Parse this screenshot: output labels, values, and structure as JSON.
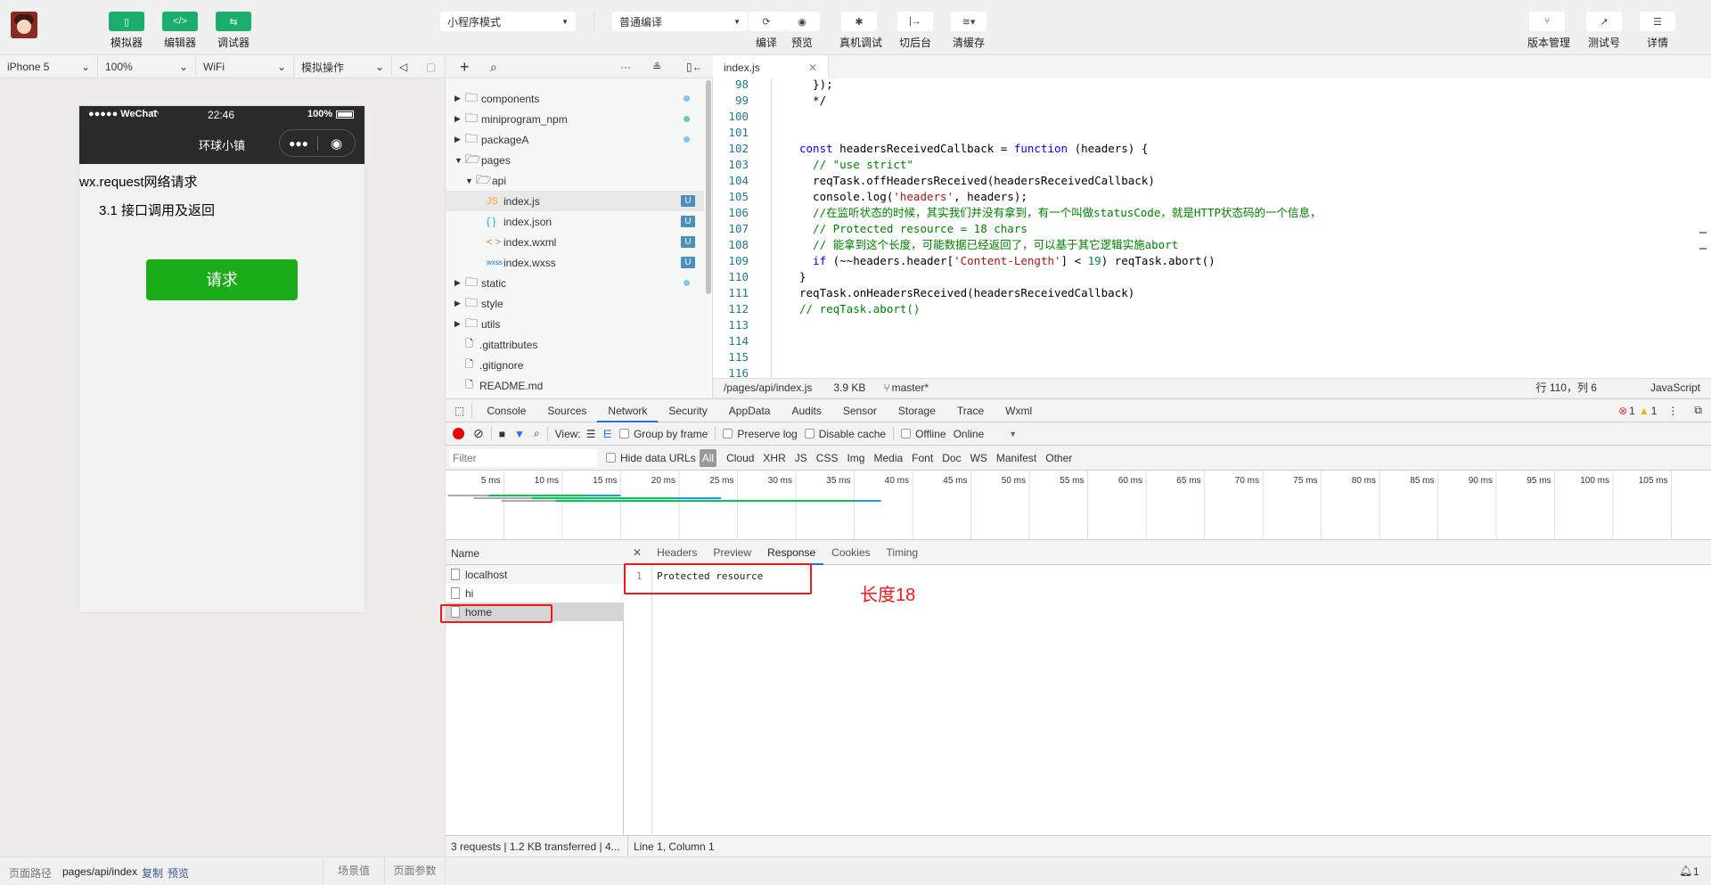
{
  "toolbar": {
    "left_buttons": [
      {
        "label": "模拟器",
        "icon": "phone-icon"
      },
      {
        "label": "编辑器",
        "icon": "code-icon"
      },
      {
        "label": "调试器",
        "icon": "debug-sliders-icon"
      }
    ],
    "mode_select": "小程序模式",
    "compile_select": "普通编译",
    "center_buttons": [
      {
        "label": "编译",
        "icon": "refresh-icon"
      },
      {
        "label": "预览",
        "icon": "eye-icon"
      },
      {
        "label": "真机调试",
        "icon": "bug-icon"
      },
      {
        "label": "切后台",
        "icon": "switch-background-icon"
      },
      {
        "label": "清缓存",
        "icon": "layers-icon"
      }
    ],
    "right_buttons": [
      {
        "label": "版本管理",
        "icon": "git-branch-icon"
      },
      {
        "label": "测试号",
        "icon": "external-link-icon"
      },
      {
        "label": "详情",
        "icon": "menu-icon"
      }
    ],
    "accent": "#1aad6b"
  },
  "simbar": {
    "device": "iPhone 5",
    "zoom": "100%",
    "network": "WiFi",
    "operation": "模拟操作"
  },
  "phone": {
    "carrier": "●●●●● WeChat",
    "time": "22:46",
    "battery": "100%",
    "nav_title": "环球小镇",
    "heading": "wx.request网络请求",
    "subheading": "3.1 接口调用及返回",
    "button": "请求",
    "button_color": "#1aad19"
  },
  "tree": {
    "items": [
      {
        "name": "components",
        "type": "folder",
        "depth": 0,
        "open": false,
        "dot": "#7cc8f8"
      },
      {
        "name": "miniprogram_npm",
        "type": "folder",
        "depth": 0,
        "open": false,
        "dot": "#5fd39a"
      },
      {
        "name": "packageA",
        "type": "folder",
        "depth": 0,
        "open": false,
        "dot": "#7cc8f8"
      },
      {
        "name": "pages",
        "type": "folder",
        "depth": 0,
        "open": true
      },
      {
        "name": "api",
        "type": "folder",
        "depth": 1,
        "open": true
      },
      {
        "name": "index.js",
        "type": "js",
        "depth": 2,
        "badge": "U",
        "selected": true
      },
      {
        "name": "index.json",
        "type": "json",
        "depth": 2,
        "badge": "U"
      },
      {
        "name": "index.wxml",
        "type": "wxml",
        "depth": 2,
        "badge": "U"
      },
      {
        "name": "index.wxss",
        "type": "wxss",
        "depth": 2,
        "badge": "U"
      },
      {
        "name": "static",
        "type": "folder",
        "depth": 0,
        "open": false,
        "dot": "#7cc8f8"
      },
      {
        "name": "style",
        "type": "folder",
        "depth": 0,
        "open": false
      },
      {
        "name": "utils",
        "type": "folder",
        "depth": 0,
        "open": false
      },
      {
        "name": ".gitattributes",
        "type": "file",
        "depth": 0
      },
      {
        "name": ".gitignore",
        "type": "file",
        "depth": 0
      },
      {
        "name": "README.md",
        "type": "file",
        "depth": 0
      }
    ]
  },
  "editor": {
    "tab": "index.js",
    "lines": [
      {
        "n": "98",
        "tokens": [
          [
            "txt",
            "  });"
          ]
        ]
      },
      {
        "n": "99",
        "tokens": [
          [
            "txt",
            "  */"
          ]
        ]
      },
      {
        "n": "100",
        "tokens": []
      },
      {
        "n": "101",
        "tokens": []
      },
      {
        "n": "102",
        "tokens": [
          [
            "kw",
            "const"
          ],
          [
            "txt",
            " headersReceivedCallback = "
          ],
          [
            "kw",
            "function"
          ],
          [
            "txt",
            " (headers) {"
          ]
        ]
      },
      {
        "n": "103",
        "tokens": [
          [
            "com",
            "  // \"use strict\""
          ]
        ]
      },
      {
        "n": "104",
        "tokens": [
          [
            "txt",
            "  reqTask.offHeadersReceived(headersReceivedCallback)"
          ]
        ]
      },
      {
        "n": "105",
        "tokens": [
          [
            "txt",
            "  console.log("
          ],
          [
            "str",
            "'headers'"
          ],
          [
            "txt",
            ", headers);"
          ]
        ]
      },
      {
        "n": "106",
        "tokens": [
          [
            "com",
            "  //在监听状态的时候，其实我们并没有拿到，有一个叫做statusCode，就是HTTP状态码的一个信息，"
          ]
        ]
      },
      {
        "n": "107",
        "tokens": [
          [
            "com",
            "  // Protected resource = 18 chars"
          ]
        ]
      },
      {
        "n": "108",
        "tokens": [
          [
            "com",
            "  // 能拿到这个长度，可能数据已经返回了，可以基于其它逻辑实施abort"
          ]
        ]
      },
      {
        "n": "109",
        "tokens": [
          [
            "kw",
            "  if"
          ],
          [
            "txt",
            " (~~headers.header["
          ],
          [
            "str",
            "'Content-Length'"
          ],
          [
            "txt",
            "] < "
          ],
          [
            "num",
            "19"
          ],
          [
            "txt",
            ") reqTask.abort()"
          ]
        ]
      },
      {
        "n": "110",
        "tokens": [
          [
            "txt",
            "}"
          ]
        ]
      },
      {
        "n": "111",
        "tokens": [
          [
            "txt",
            "reqTask.onHeadersReceived(headersReceivedCallback)"
          ]
        ]
      },
      {
        "n": "112",
        "tokens": [
          [
            "com",
            "// reqTask.abort()"
          ]
        ]
      },
      {
        "n": "113",
        "tokens": []
      },
      {
        "n": "114",
        "tokens": []
      },
      {
        "n": "115",
        "tokens": []
      },
      {
        "n": "116",
        "tokens": []
      }
    ],
    "status": {
      "path": "/pages/api/index.js",
      "size": "3.9 KB",
      "branch": "master*",
      "cursor": "行 110，列 6",
      "language": "JavaScript"
    }
  },
  "devtools": {
    "tabs": [
      "Console",
      "Sources",
      "Network",
      "Security",
      "AppData",
      "Audits",
      "Sensor",
      "Storage",
      "Trace",
      "Wxml"
    ],
    "active_tab": "Network",
    "errors": "1",
    "warnings": "1",
    "toolbar": {
      "view_label": "View:",
      "group_by_frame": "Group by frame",
      "preserve_log": "Preserve log",
      "disable_cache": "Disable cache",
      "offline": "Offline",
      "throttle": "Online"
    },
    "filter_placeholder": "Filter",
    "hide_data_urls": "Hide data URLs",
    "filter_types": [
      "All",
      "Cloud",
      "XHR",
      "JS",
      "CSS",
      "Img",
      "Media",
      "Font",
      "Doc",
      "WS",
      "Manifest",
      "Other"
    ],
    "active_filter": "All"
  },
  "chart_data": {
    "type": "waterfall",
    "x_unit": "ms",
    "tick_labels": [
      "5 ms",
      "10 ms",
      "15 ms",
      "20 ms",
      "25 ms",
      "30 ms",
      "35 ms",
      "40 ms",
      "45 ms",
      "50 ms",
      "55 ms",
      "60 ms",
      "65 ms",
      "70 ms",
      "75 ms",
      "80 ms",
      "85 ms",
      "90 ms",
      "95 ms",
      "100 ms",
      "105 ms",
      "11"
    ],
    "xlim": [
      0,
      110
    ],
    "series": [
      {
        "start": 0.2,
        "waiting": 3.7,
        "download": 12,
        "end": 15
      },
      {
        "start": 2.4,
        "waiting": 7.4,
        "download": 19.6,
        "end": 23.6
      },
      {
        "start": 4.8,
        "waiting": 9.4,
        "download": 35,
        "end": 37.3
      }
    ],
    "colors": {
      "queue": "#aaaaaa",
      "waiting": "#00c853",
      "download": "#1a9bf0"
    }
  },
  "requests": {
    "header": "Name",
    "items": [
      "localhost",
      "hi",
      "home"
    ],
    "selected": "home"
  },
  "details": {
    "tabs": [
      "Headers",
      "Preview",
      "Response",
      "Cookies",
      "Timing"
    ],
    "active_tab": "Response",
    "response_line_no": "1",
    "response_text": "Protected resource",
    "annotation": "长度18"
  },
  "netstatus": {
    "summary": "3 requests | 1.2 KB transferred | 4...",
    "position": "Line 1, Column 1"
  },
  "bottombar": {
    "path_label": "页面路径",
    "path": "pages/api/index",
    "copy": "复制",
    "preview": "预览",
    "scene": "场景值",
    "params": "页面参数",
    "notifications": "1"
  }
}
